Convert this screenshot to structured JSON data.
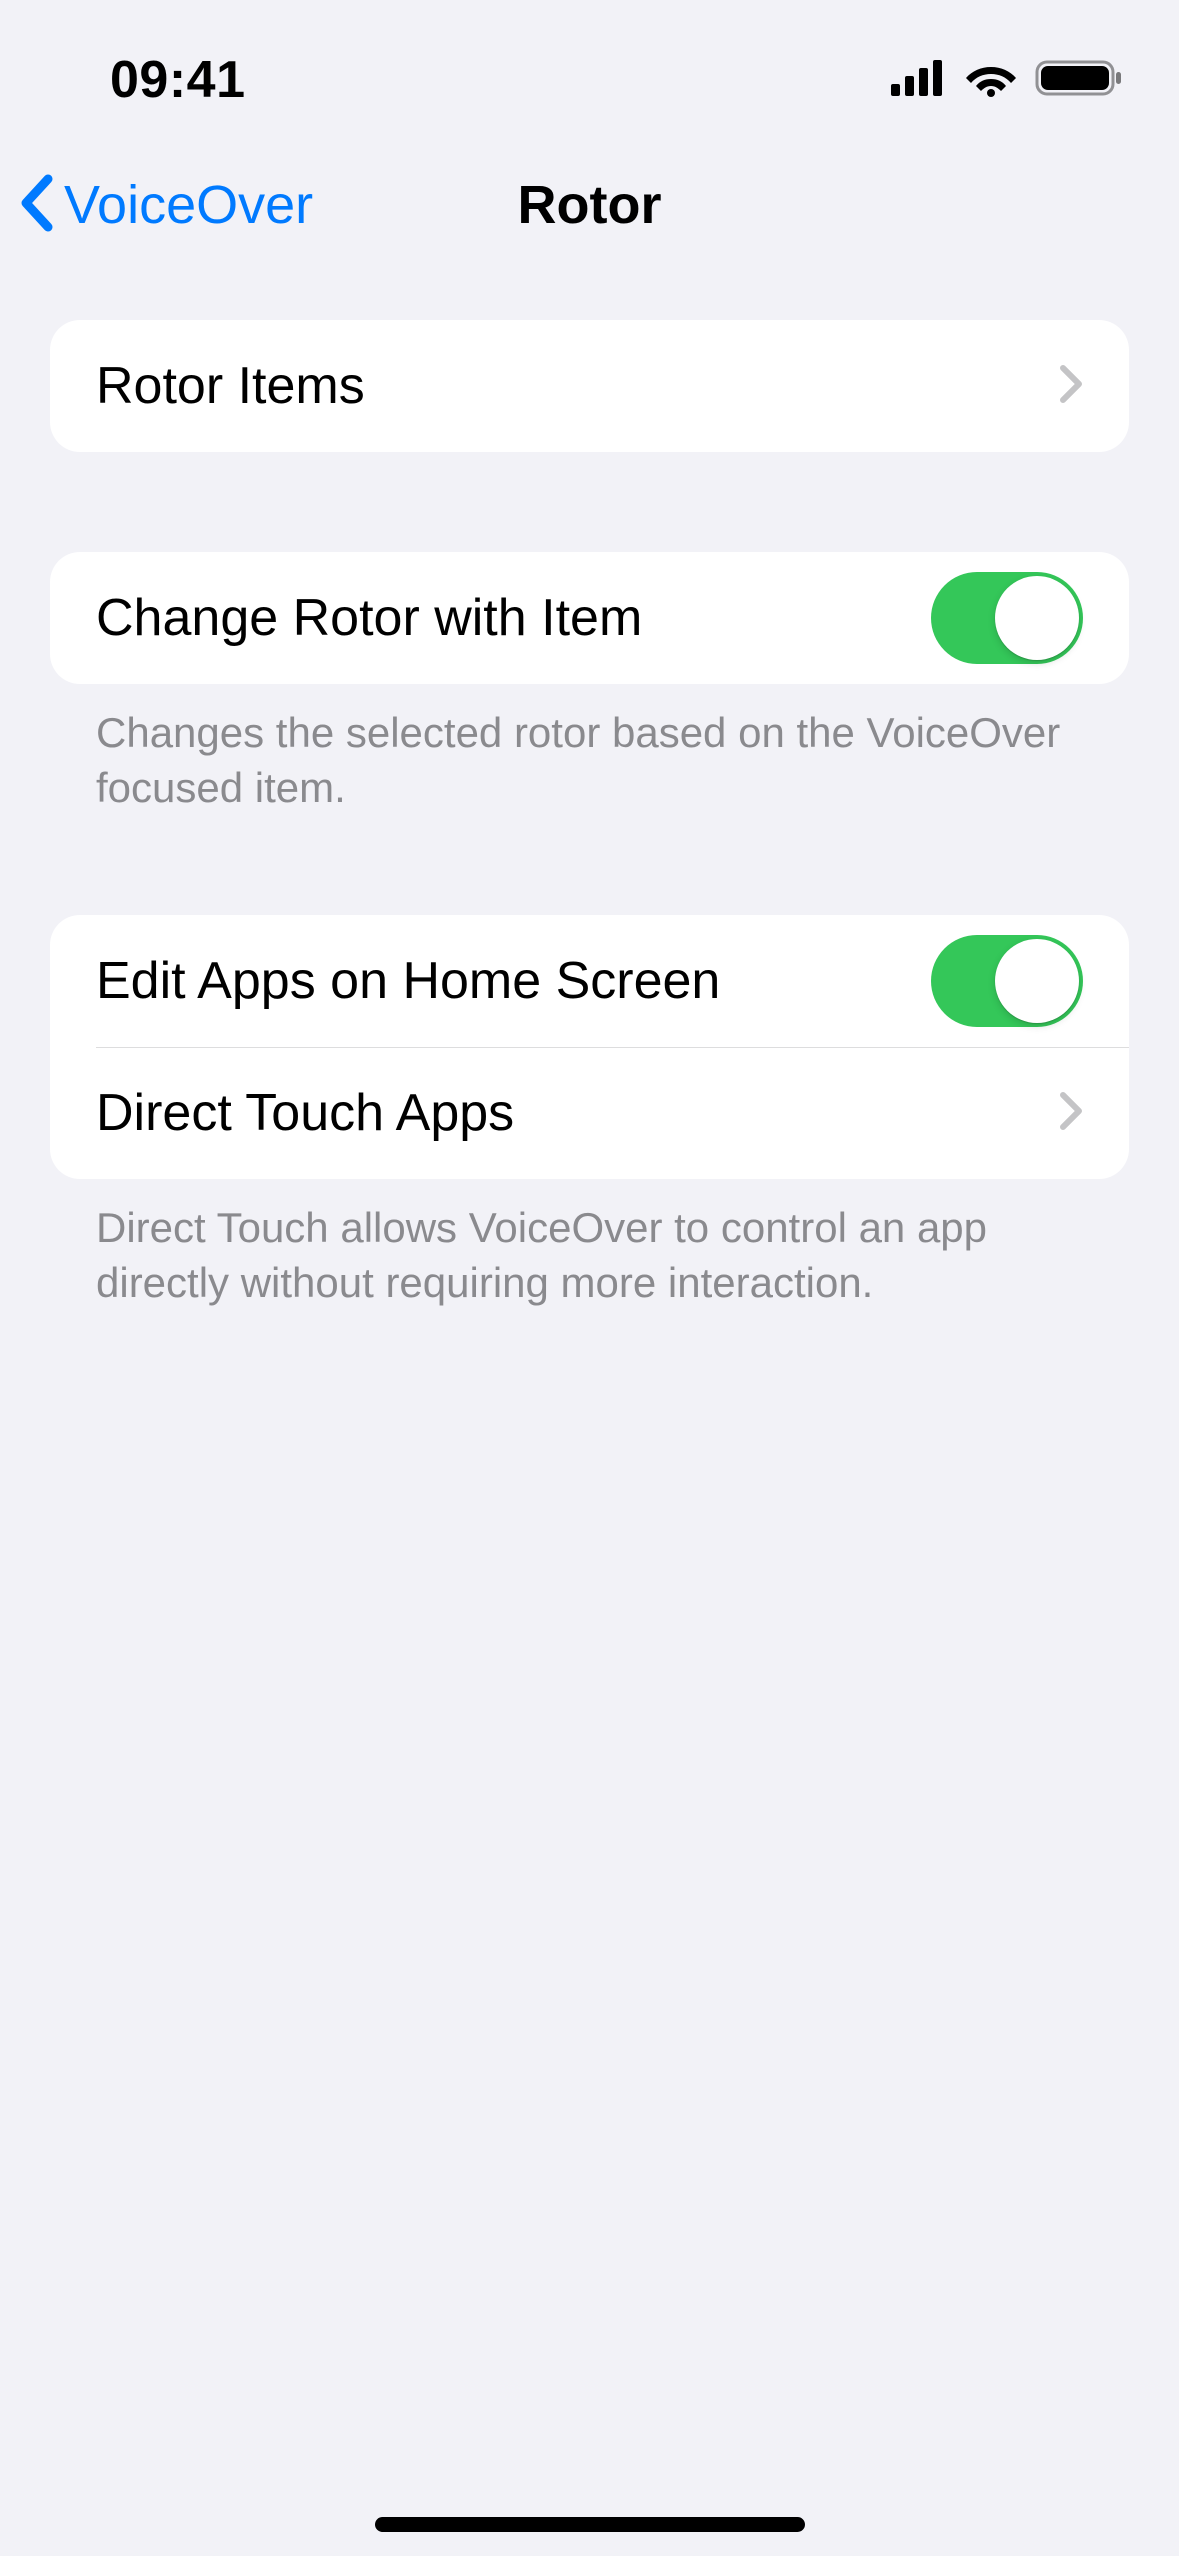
{
  "status_bar": {
    "time": "09:41"
  },
  "nav": {
    "back_label": "VoiceOver",
    "title": "Rotor"
  },
  "groups": [
    {
      "rows": [
        {
          "label": "Rotor Items",
          "type": "disclosure"
        }
      ]
    },
    {
      "rows": [
        {
          "label": "Change Rotor with Item",
          "type": "toggle",
          "value": true
        }
      ],
      "footer": "Changes the selected rotor based on the VoiceOver focused item."
    },
    {
      "rows": [
        {
          "label": "Edit Apps on Home Screen",
          "type": "toggle",
          "value": true
        },
        {
          "label": "Direct Touch Apps",
          "type": "disclosure"
        }
      ],
      "footer": "Direct Touch allows VoiceOver to control an app directly without requiring more interaction."
    }
  ]
}
